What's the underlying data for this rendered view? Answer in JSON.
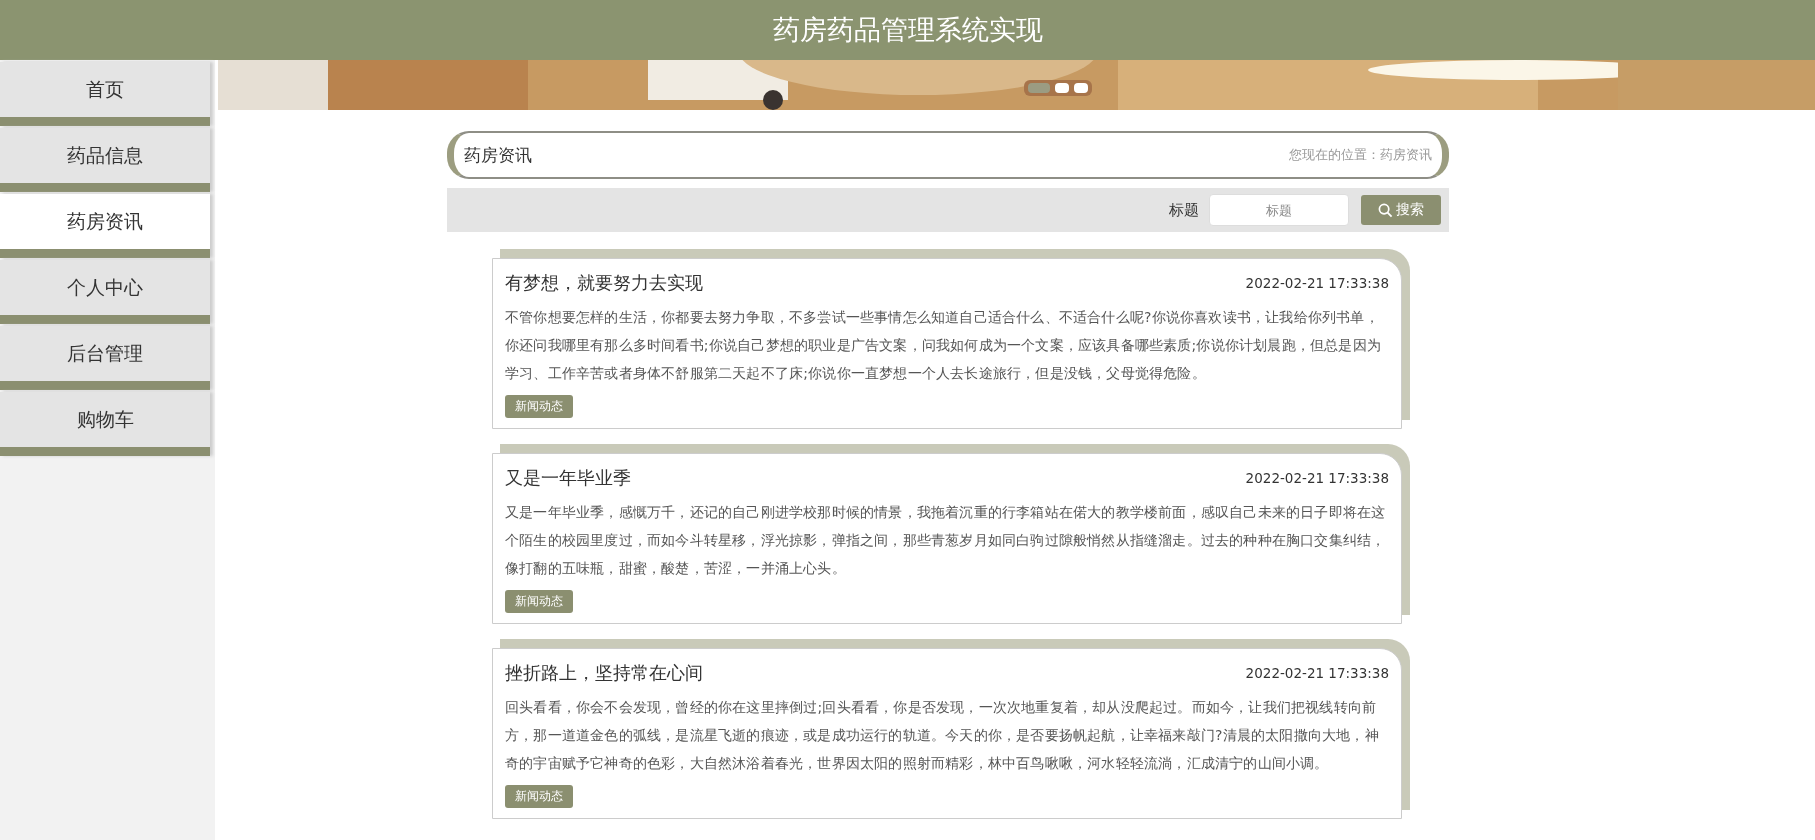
{
  "header": {
    "title": "药房药品管理系统实现"
  },
  "sidebar": {
    "items": [
      {
        "label": "首页",
        "selected": false
      },
      {
        "label": "药品信息",
        "selected": false
      },
      {
        "label": "药房资讯",
        "selected": true
      },
      {
        "label": "个人中心",
        "selected": false
      },
      {
        "label": "后台管理",
        "selected": false
      },
      {
        "label": "购物车",
        "selected": false
      }
    ]
  },
  "banner": {
    "kind": "picture",
    "slides": [
      {
        "selected": true
      },
      {
        "selected": false
      },
      {
        "selected": false
      }
    ]
  },
  "section": {
    "title": "药房资讯",
    "breadcrumb": "您现在的位置：药房资讯"
  },
  "search": {
    "label": "标题",
    "placeholder": "标题",
    "button": "搜索"
  },
  "articles": [
    {
      "title": "有梦想，就要努力去实现",
      "date": "2022-02-21 17:33:38",
      "text": "不管你想要怎样的生活，你都要去努力争取，不多尝试一些事情怎么知道自己适合什么、不适合什么呢?你说你喜欢读书，让我给你列书单，你还问我哪里有那么多时间看书;你说自己梦想的职业是广告文案，问我如何成为一个文案，应该具备哪些素质;你说你计划晨跑，但总是因为学习、工作辛苦或者身体不舒服第二天起不了床;你说你一直梦想一个人去长途旅行，但是没钱，父母觉得危险。",
      "tag": "新闻动态"
    },
    {
      "title": "又是一年毕业季",
      "date": "2022-02-21 17:33:38",
      "text": "又是一年毕业季，感慨万千，还记的自己刚进学校那时候的情景，我拖着沉重的行李箱站在偌大的教学楼前面，感叹自己未来的日子即将在这个陌生的校园里度过，而如今斗转星移，浮光掠影，弹指之间，那些青葱岁月如同白驹过隙般悄然从指缝溜走。过去的种种在胸口交集纠结，像打翻的五味瓶，甜蜜，酸楚，苦涩，一并涌上心头。",
      "tag": "新闻动态"
    },
    {
      "title": "挫折路上，坚持常在心间",
      "date": "2022-02-21 17:33:38",
      "text": "回头看看，你会不会发现，曾经的你在这里摔倒过;回头看看，你是否发现，一次次地重复着，却从没爬起过。而如今，让我们把视线转向前方，那一道道金色的弧线，是流星飞逝的痕迹，或是成功运行的轨道。今天的你，是否要扬帆起航，让幸福来敲门?清晨的太阳撒向大地，神奇的宇宙赋予它神奇的色彩，大自然沐浴着春光，世界因太阳的照射而精彩，林中百鸟啾啾，河水轻轻流淌，汇成清宁的山间小调。",
      "tag": "新闻动态"
    }
  ]
}
